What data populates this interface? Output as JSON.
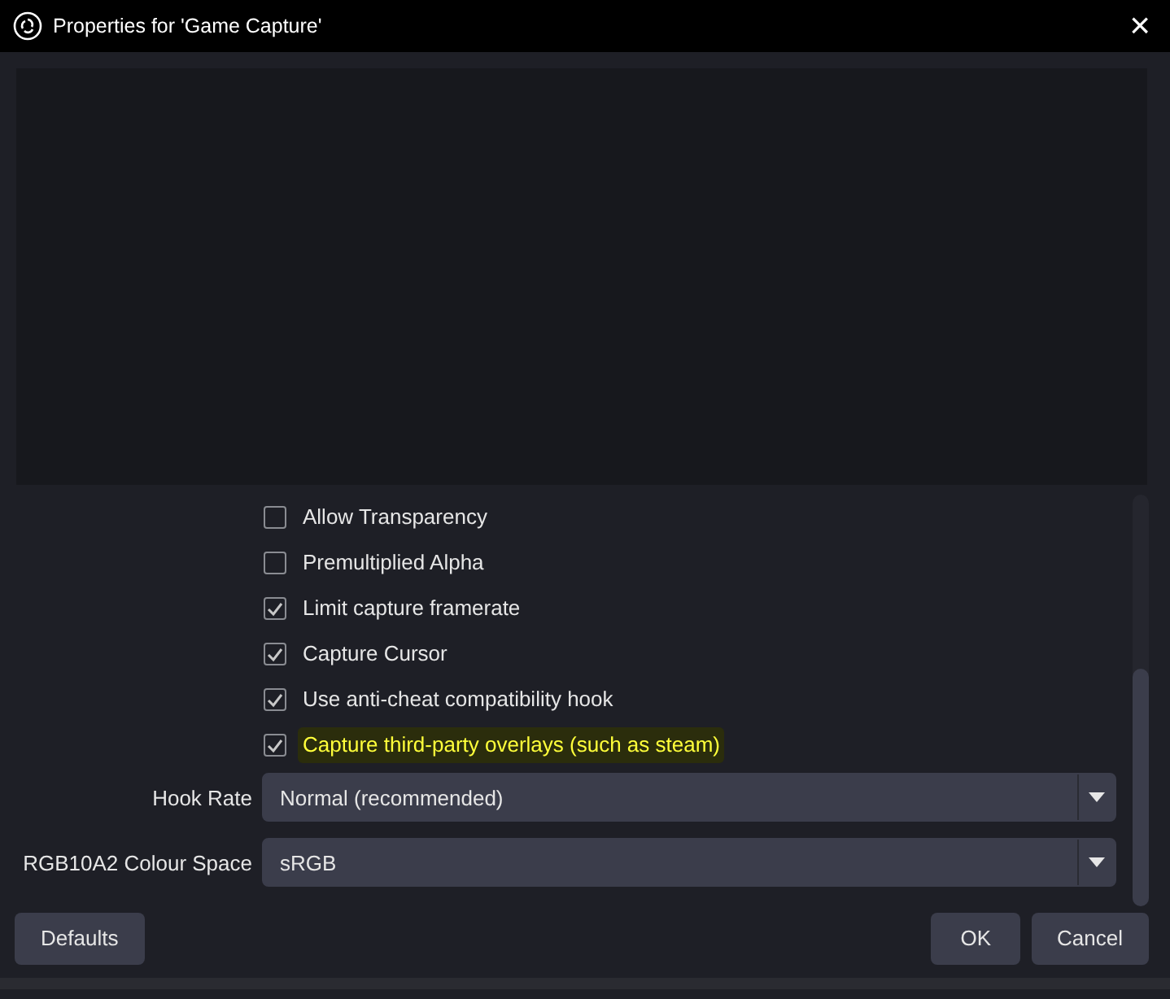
{
  "window": {
    "title": "Properties for 'Game Capture'",
    "close": "×"
  },
  "checkboxes": [
    {
      "label": "Allow Transparency",
      "checked": false,
      "highlighted": false
    },
    {
      "label": "Premultiplied Alpha",
      "checked": false,
      "highlighted": false
    },
    {
      "label": "Limit capture framerate",
      "checked": true,
      "highlighted": false
    },
    {
      "label": "Capture Cursor",
      "checked": true,
      "highlighted": false
    },
    {
      "label": "Use anti-cheat compatibility hook",
      "checked": true,
      "highlighted": false
    },
    {
      "label": "Capture third-party overlays (such as steam)",
      "checked": true,
      "highlighted": true
    }
  ],
  "selects": [
    {
      "label": "Hook Rate",
      "value": "Normal (recommended)"
    },
    {
      "label": "RGB10A2 Colour Space",
      "value": "sRGB"
    }
  ],
  "buttons": {
    "left": [
      "Defaults"
    ],
    "right": [
      "OK",
      "Cancel"
    ]
  }
}
